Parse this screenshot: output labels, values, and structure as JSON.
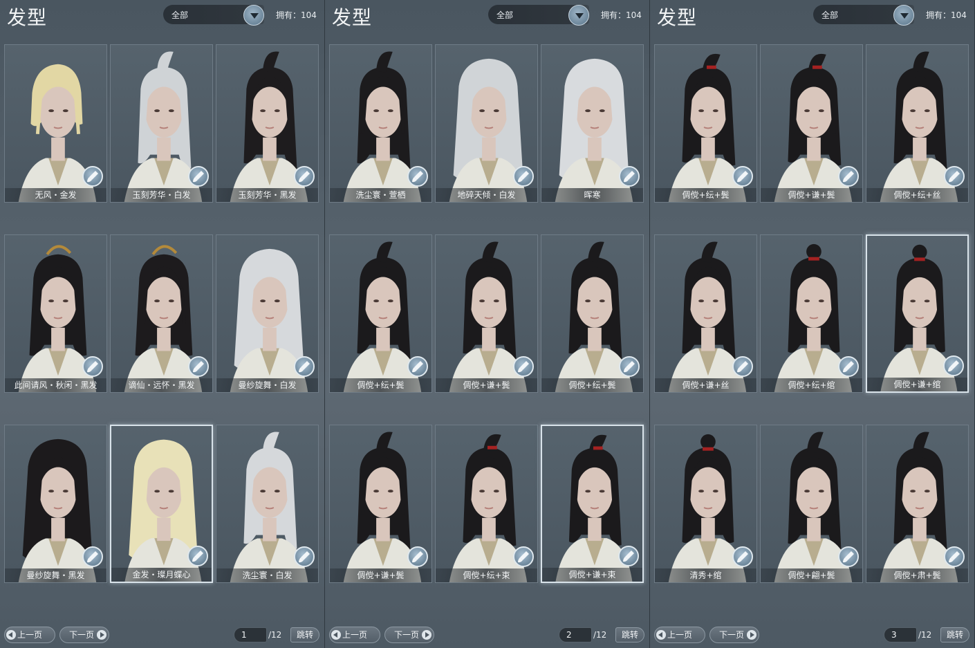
{
  "panels": [
    {
      "title": "发型",
      "filter": "全部",
      "owned": "拥有：104",
      "items": [
        {
          "label": "无风・金发",
          "hair": "#e2d7a4",
          "style": "short"
        },
        {
          "label": "玉刻芳华・白发",
          "hair": "#cfd3d6",
          "style": "pony"
        },
        {
          "label": "玉刻芳华・黑发",
          "hair": "#1e1c1e",
          "style": "pony"
        },
        {
          "label": "此间请风・秋闲・黑发",
          "hair": "#1b1a1c",
          "style": "crown"
        },
        {
          "label": "谪仙・远怀・黑发",
          "hair": "#1d1b1d",
          "style": "crown"
        },
        {
          "label": "曼纱旋舞・白发",
          "hair": "#d6d9dc",
          "style": "long"
        },
        {
          "label": "曼纱旋舞・黑发",
          "hair": "#1c1a1c",
          "style": "long"
        },
        {
          "label": "金发・璨月蝶心",
          "hair": "#e8e1b8",
          "style": "long"
        },
        {
          "label": "洗尘寰・白发",
          "hair": "#d5d8db",
          "style": "pony"
        }
      ],
      "selected": 7,
      "prev": "上一页",
      "next": "下一页",
      "page": "1",
      "total": "/12",
      "jump": "跳转"
    },
    {
      "title": "发型",
      "filter": "全部",
      "owned": "拥有：104",
      "items": [
        {
          "label": "洗尘寰・萱栖",
          "hair": "#1c1b1d",
          "style": "pony"
        },
        {
          "label": "地碎天倾・白发",
          "hair": "#d0d4d7",
          "style": "long"
        },
        {
          "label": "晖寒",
          "hair": "#d8dbde",
          "style": "long"
        },
        {
          "label": "倜傥+纭+鬓",
          "hair": "#1b1a1c",
          "style": "pony"
        },
        {
          "label": "倜傥+谦+鬓",
          "hair": "#1b1a1c",
          "style": "pony"
        },
        {
          "label": "倜傥+纭+鬓",
          "hair": "#1b1a1c",
          "style": "pony"
        },
        {
          "label": "倜傥+谦+鬓",
          "hair": "#1b1a1c",
          "style": "pony"
        },
        {
          "label": "倜傥+纭+束",
          "hair": "#1b1a1c",
          "style": "tie"
        },
        {
          "label": "倜傥+谦+束",
          "hair": "#1b1a1c",
          "style": "tie"
        }
      ],
      "selected": 8,
      "prev": "上一页",
      "next": "下一页",
      "page": "2",
      "total": "/12",
      "jump": "跳转"
    },
    {
      "title": "发型",
      "filter": "全部",
      "owned": "拥有：104",
      "items": [
        {
          "label": "倜傥+纭+鬓",
          "hair": "#1b1a1c",
          "style": "tie"
        },
        {
          "label": "倜傥+谦+鬓",
          "hair": "#1b1a1c",
          "style": "tie"
        },
        {
          "label": "倜傥+纭+丝",
          "hair": "#1b1a1c",
          "style": "pony"
        },
        {
          "label": "倜傥+谦+丝",
          "hair": "#1b1a1c",
          "style": "pony"
        },
        {
          "label": "倜傥+纭+绾",
          "hair": "#1b1a1c",
          "style": "bun"
        },
        {
          "label": "倜傥+谦+绾",
          "hair": "#1b1a1c",
          "style": "bun"
        },
        {
          "label": "清秀+绾",
          "hair": "#1b1a1c",
          "style": "bun"
        },
        {
          "label": "倜傥+翩+鬓",
          "hair": "#1b1a1c",
          "style": "pony"
        },
        {
          "label": "倜傥+肃+鬓",
          "hair": "#1b1a1c",
          "style": "pony"
        }
      ],
      "selected": 5,
      "prev": "上一页",
      "next": "下一页",
      "page": "3",
      "total": "/12",
      "jump": "跳转"
    }
  ]
}
